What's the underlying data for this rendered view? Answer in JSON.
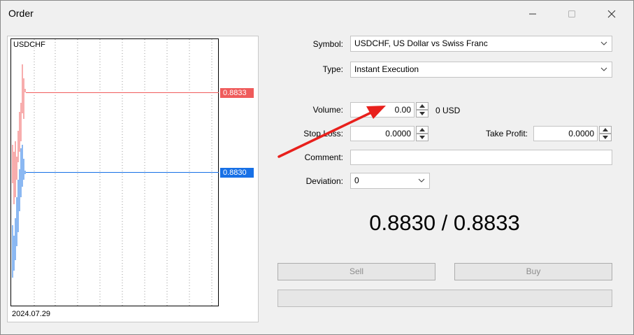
{
  "window": {
    "title": "Order"
  },
  "chart": {
    "symbol": "USDCHF",
    "date": "2024.07.29",
    "ask_price": "0.8833",
    "bid_price": "0.8830",
    "ask_color": "#ef5b5b",
    "bid_color": "#1770e6"
  },
  "form": {
    "symbol_label": "Symbol:",
    "symbol_value": "USDCHF, US Dollar vs Swiss Franc",
    "type_label": "Type:",
    "type_value": "Instant Execution",
    "volume_label": "Volume:",
    "volume_value": "0.00",
    "volume_unit": "0 USD",
    "stop_loss_label": "Stop Loss:",
    "stop_loss_value": "0.0000",
    "take_profit_label": "Take Profit:",
    "take_profit_value": "0.0000",
    "comment_label": "Comment:",
    "comment_value": "",
    "deviation_label": "Deviation:",
    "deviation_value": "0"
  },
  "quote": "0.8830 / 0.8833",
  "buttons": {
    "sell": "Sell",
    "buy": "Buy"
  },
  "icons": {
    "minimize": "minimize-icon",
    "maximize": "maximize-icon",
    "close": "close-icon",
    "dropdown": "chevron-down-icon",
    "spin_up": "spin-up-icon",
    "spin_down": "spin-down-icon",
    "annotation": "red-arrow-annotation"
  },
  "annotation_color": "#e8201c"
}
